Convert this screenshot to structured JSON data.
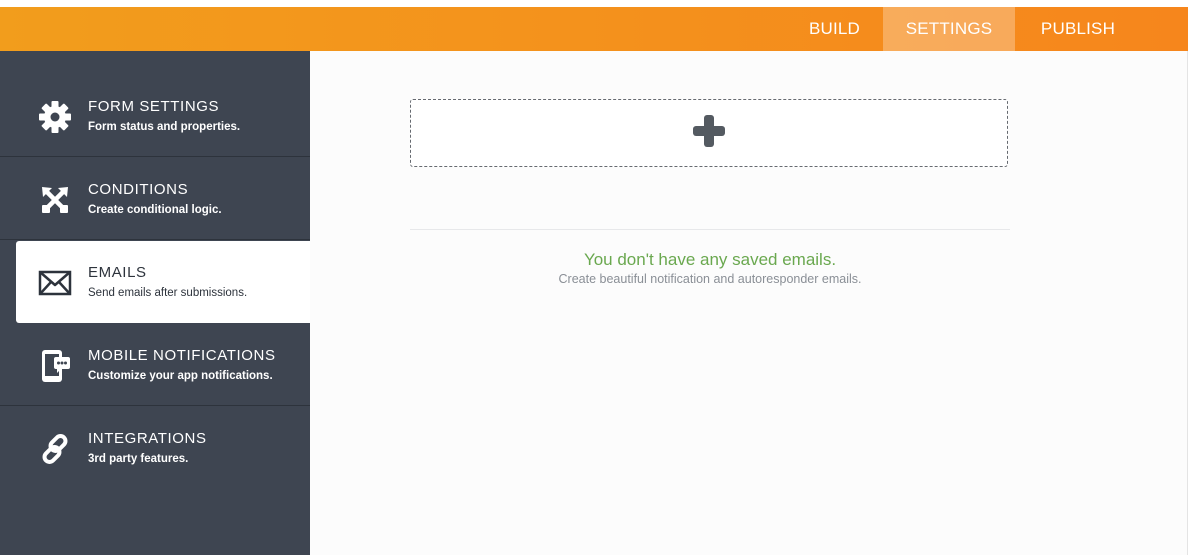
{
  "colors": {
    "accent": "#f6861c",
    "sidebar_bg": "#3e4551",
    "empty_title": "#6aa84f"
  },
  "topnav": {
    "tabs": [
      {
        "label": "BUILD",
        "active": false
      },
      {
        "label": "SETTINGS",
        "active": true
      },
      {
        "label": "PUBLISH",
        "active": false
      }
    ]
  },
  "sidebar": {
    "items": [
      {
        "icon": "gear-icon",
        "title": "FORM SETTINGS",
        "subtitle": "Form status and properties.",
        "active": false
      },
      {
        "icon": "conditions-icon",
        "title": "CONDITIONS",
        "subtitle": "Create conditional logic.",
        "active": false
      },
      {
        "icon": "envelope-icon",
        "title": "EMAILS",
        "subtitle": "Send emails after submissions.",
        "active": true
      },
      {
        "icon": "mobile-notification-icon",
        "title": "MOBILE NOTIFICATIONS",
        "subtitle": "Customize your app notifications.",
        "active": false
      },
      {
        "icon": "link-icon",
        "title": "INTEGRATIONS",
        "subtitle": "3rd party features.",
        "active": false
      }
    ]
  },
  "main": {
    "add_icon": "plus-icon",
    "empty_title": "You don't have any saved emails.",
    "empty_subtitle": "Create beautiful notification and autoresponder emails."
  }
}
